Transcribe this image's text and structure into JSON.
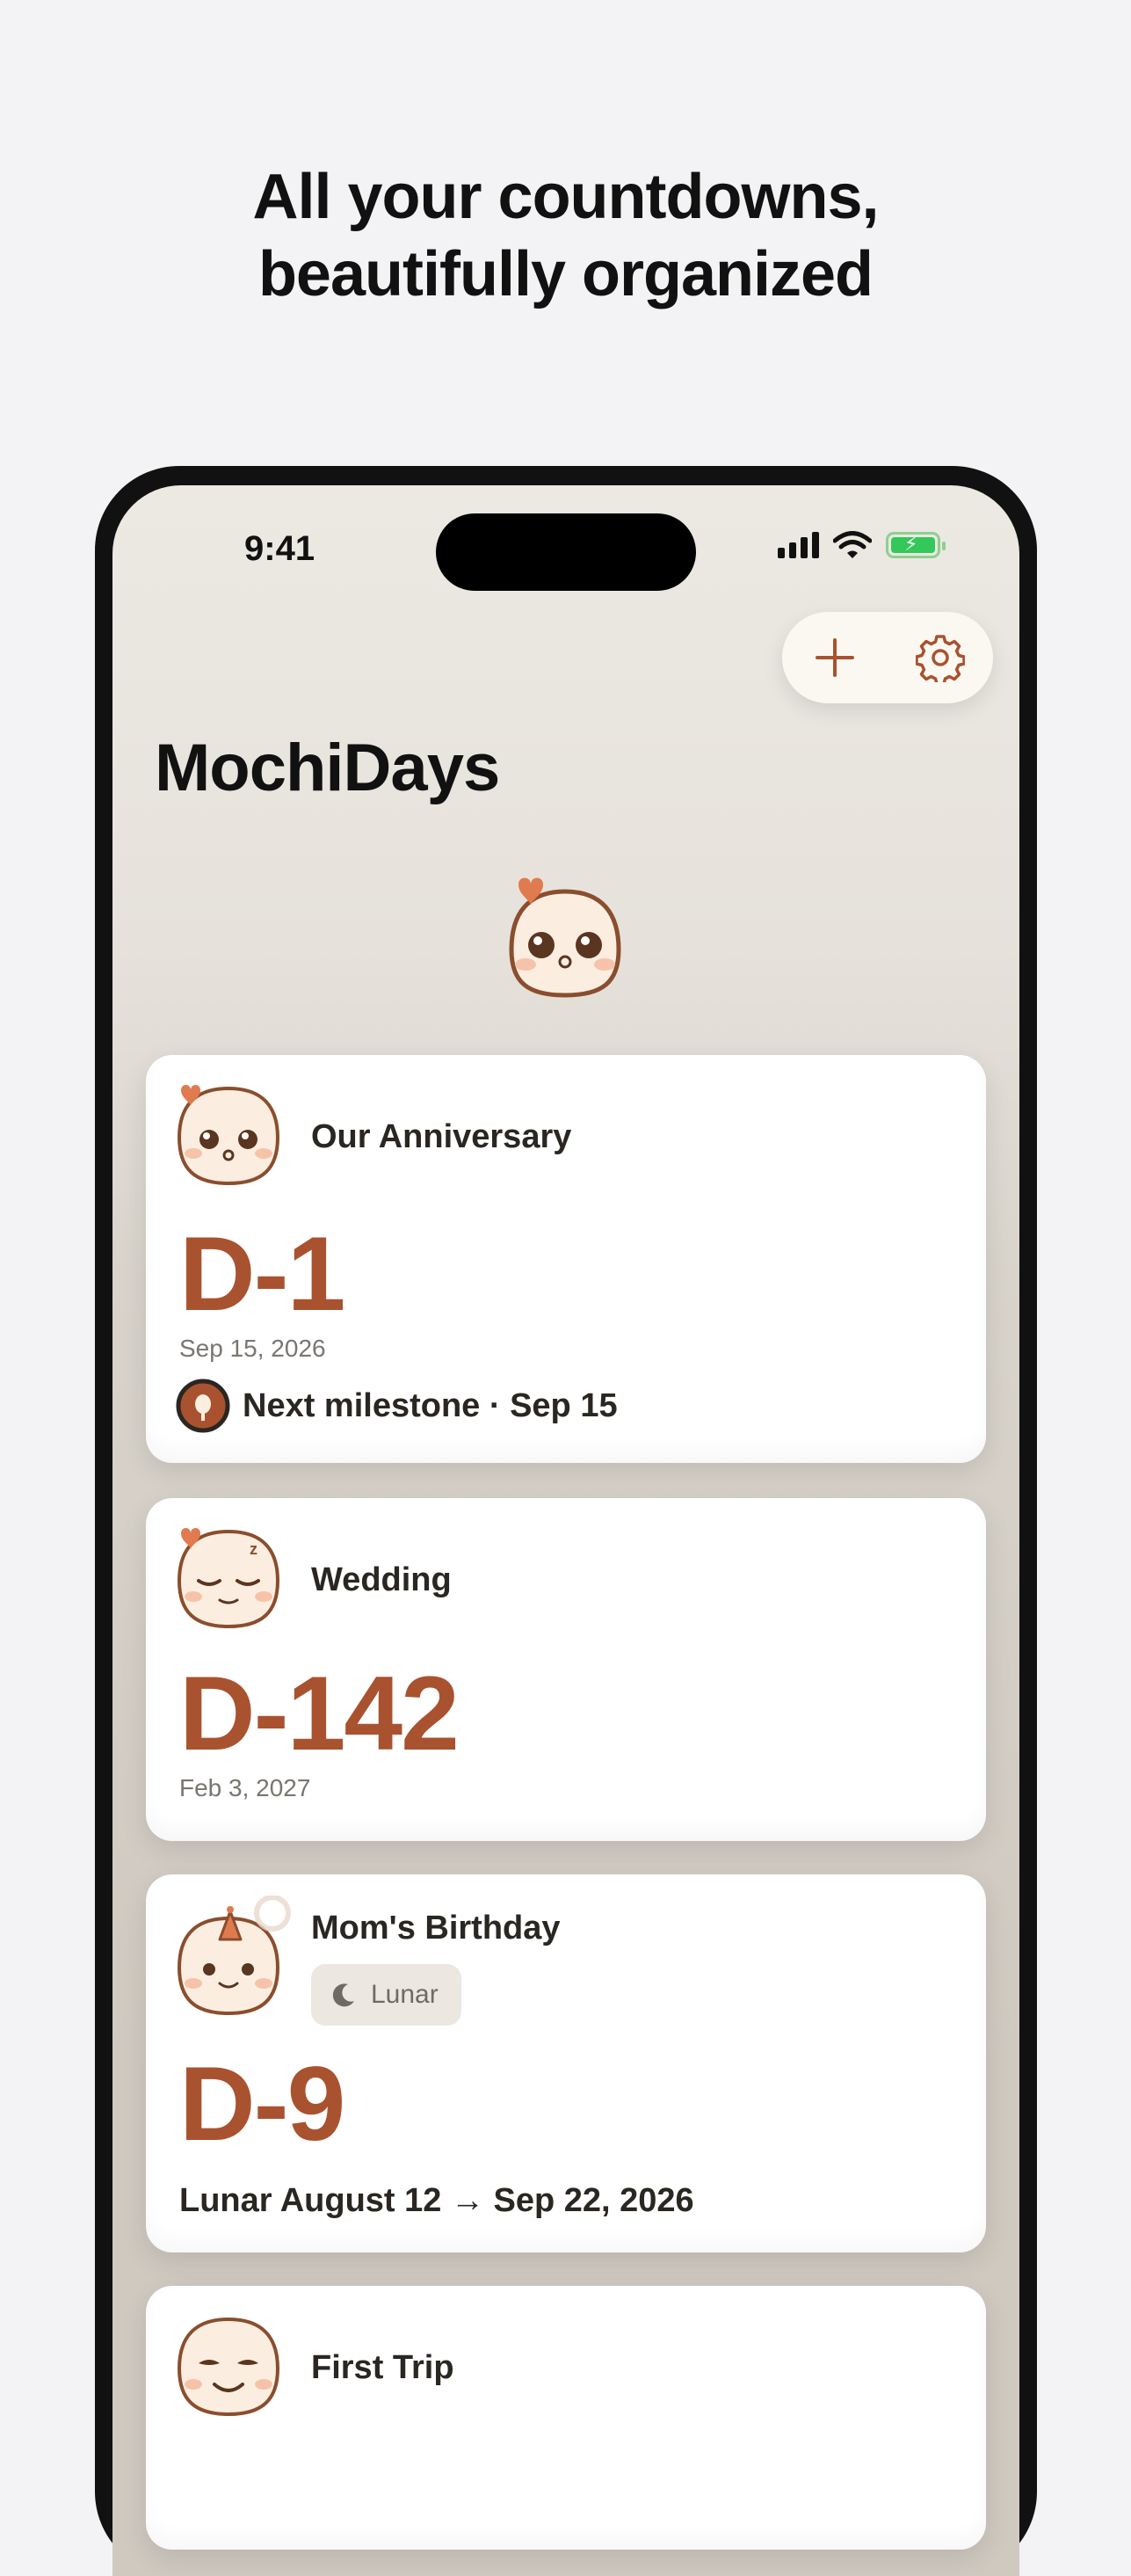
{
  "headline": {
    "line1": "All your countdowns,",
    "line2": "beautifully organized"
  },
  "status_bar": {
    "time": "9:41"
  },
  "app": {
    "title": "MochiDays"
  },
  "toolbar": {
    "add_icon": "plus-icon",
    "settings_icon": "gear-icon"
  },
  "cards": [
    {
      "title": "Our Anniversary",
      "dday": "D-1",
      "date": "Sep 15, 2026",
      "milestone": "Next milestone · Sep 15"
    },
    {
      "title": "Wedding",
      "dday": "D-142",
      "date": "Feb 3, 2027"
    },
    {
      "title": "Mom's Birthday",
      "badge": "Lunar",
      "dday": "D-9",
      "lunar_line": "Lunar August 12 → Sep 22, 2026"
    },
    {
      "title": "First Trip"
    }
  ],
  "colors": {
    "accent": "#a9522f",
    "mochi_outline": "#8a4e2e",
    "mochi_fill": "#fbeee0",
    "heart": "#e07a4f"
  }
}
